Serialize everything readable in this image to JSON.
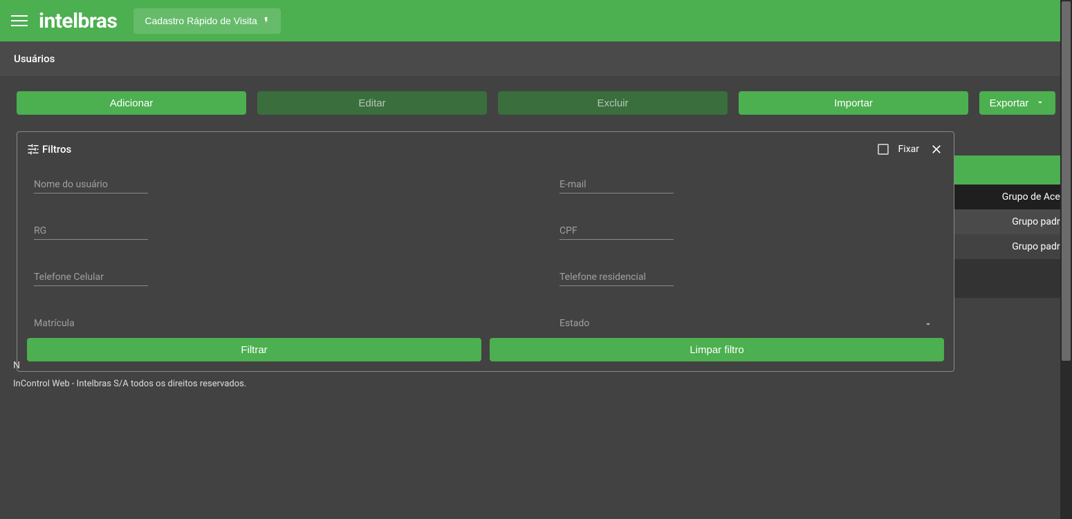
{
  "topbar": {
    "brand": "intelbras",
    "quick_visit_label": "Cadastro Rápido de Visita"
  },
  "page": {
    "title": "Usuários"
  },
  "actions": {
    "add": "Adicionar",
    "edit": "Editar",
    "delete": "Excluir",
    "import": "Importar",
    "export": "Exportar"
  },
  "filters": {
    "title": "Filtros",
    "pin_label": "Fixar",
    "fields": {
      "username": "Nome do usuário",
      "email": "E-mail",
      "rg": "RG",
      "cpf": "CPF",
      "cellphone": "Telefone Celular",
      "homephone": "Telefone residencial",
      "registration": "Matrícula",
      "state": "Estado"
    },
    "filter_btn": "Filtrar",
    "clear_btn": "Limpar filtro"
  },
  "table": {
    "column_group": "Grupo de Aces",
    "row_group_value": "Grupo padrã"
  },
  "pagination_fragment": "N",
  "footer": "InControl Web - Intelbras S/A todos os direitos reservados."
}
